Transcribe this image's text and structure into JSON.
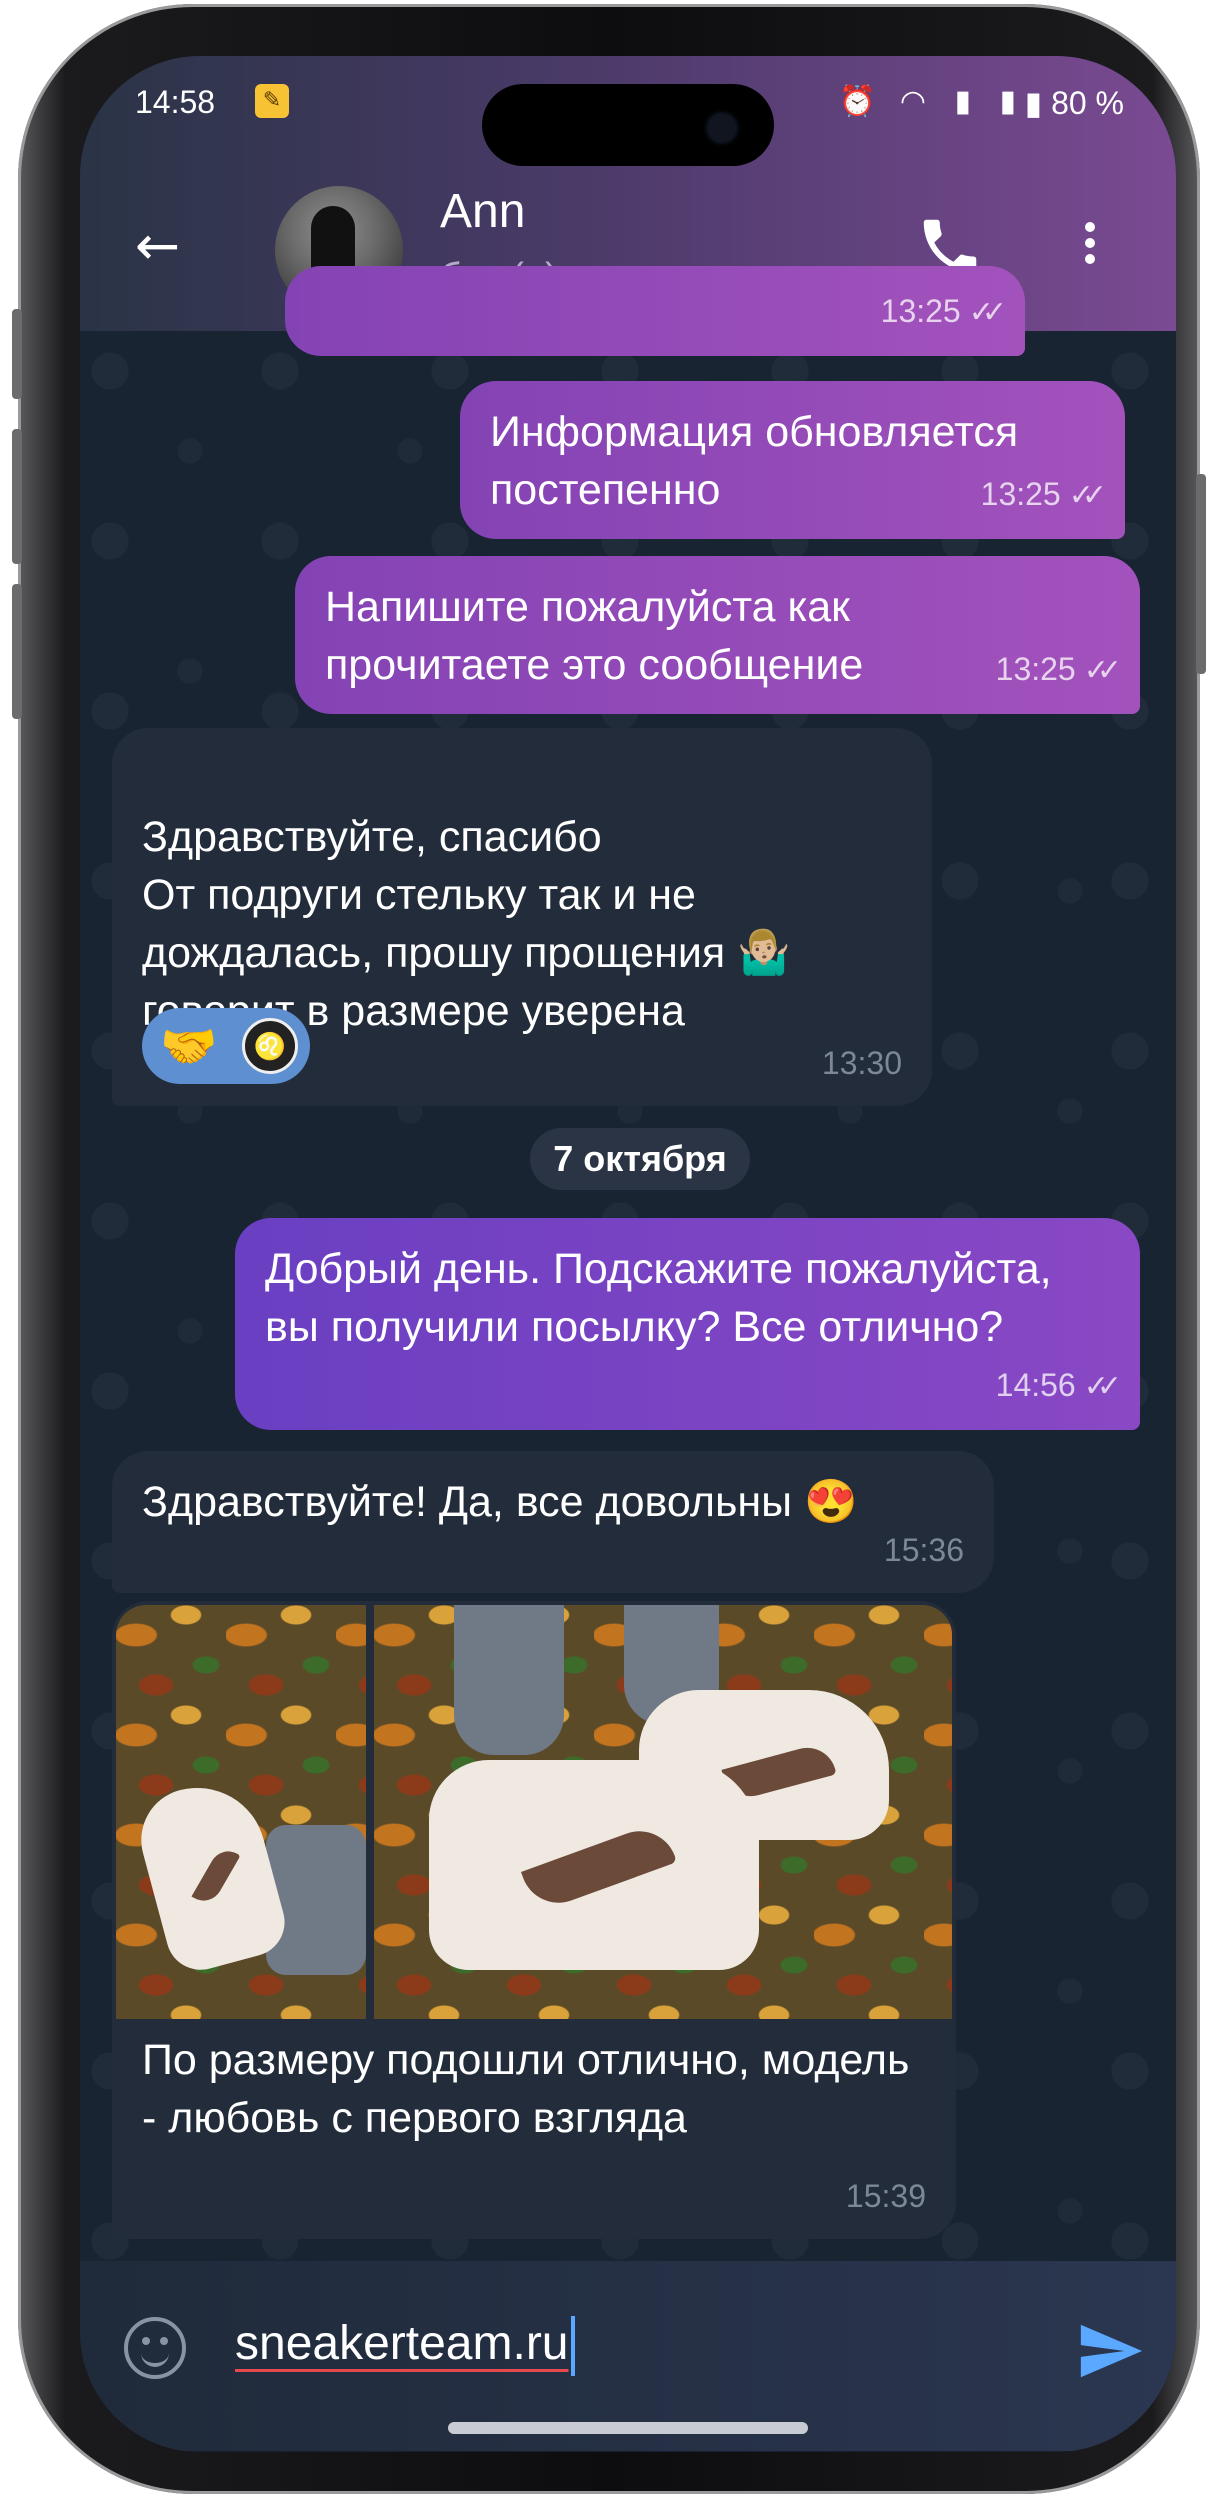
{
  "status_bar": {
    "time": "14:58",
    "battery": "80 %"
  },
  "header": {
    "contact_name": "Ann",
    "last_seen": "был(а) недавно"
  },
  "messages": {
    "m1_cut": {
      "time": "13:25"
    },
    "m2": {
      "text": "Информация обновляется постепенно",
      "time": "13:25"
    },
    "m3": {
      "text": "Напишите пожалуйста как прочитаете это сообщение",
      "time": "13:25"
    },
    "m4": {
      "text": "Здравствуйте, спасибо\nОт подруги стельку так и не дождалась, прошу прощения 🤷🏼‍♂️ говорит в размере уверена",
      "time": "13:30",
      "reaction": "🤝"
    },
    "date_divider": "7 октября",
    "m5": {
      "text": "Добрый день. Подскажите пожалуйста, вы получили посылку? Все отлично?",
      "time": "14:56"
    },
    "m6": {
      "text": "Здравствуйте! Да, все довольны 😍",
      "time": "15:36"
    },
    "m7": {
      "caption": "По размеру подошли отлично, модель - любовь с первого взгляда",
      "time": "15:39"
    }
  },
  "composer": {
    "input_value": "sneakerteam.ru"
  },
  "icons": {
    "back": "arrow-left-icon",
    "call": "phone-icon",
    "menu": "more-vertical-icon",
    "emoji": "emoji-icon",
    "send": "send-icon"
  },
  "colors": {
    "outgoing_bubble": "#9a4bbd",
    "incoming_bubble": "#222c3a",
    "accent": "#5aa8ff"
  }
}
